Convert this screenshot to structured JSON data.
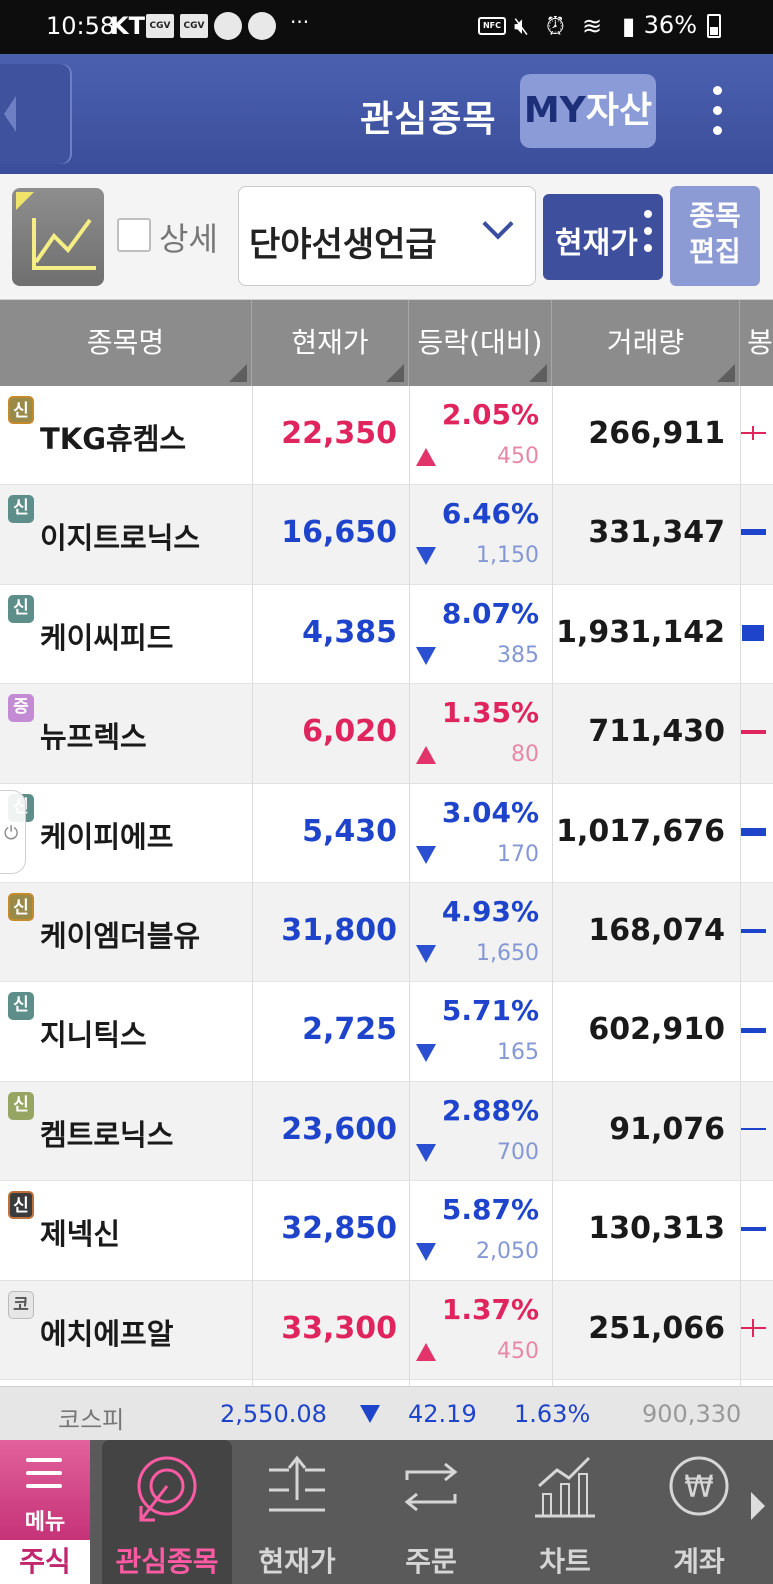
{
  "status_bar": {
    "time": "10:58",
    "carrier": "KT",
    "badges": [
      "CGV",
      "CGV"
    ],
    "dots": "···",
    "battery": "36%"
  },
  "header": {
    "title": "관심종목",
    "my_asset_prefix": "MY",
    "my_asset_suffix": "자산"
  },
  "toolbar": {
    "detail_label": "상세",
    "group_value": "단야선생언급",
    "price_mode": "현재가",
    "edit_line1": "종목",
    "edit_line2": "편집"
  },
  "columns": [
    "종목명",
    "현재가",
    "등락(대비)",
    "거래량",
    "봉"
  ],
  "rows": [
    {
      "badge": "신",
      "name": "TKG휴켐스",
      "price": "22,350",
      "pct": "2.05%",
      "diff": "450",
      "direction": "up",
      "volume": "266,911"
    },
    {
      "badge": "신",
      "name": "이지트로닉스",
      "price": "16,650",
      "pct": "6.46%",
      "diff": "1,150",
      "direction": "down",
      "volume": "331,347"
    },
    {
      "badge": "신",
      "name": "케이씨피드",
      "price": "4,385",
      "pct": "8.07%",
      "diff": "385",
      "direction": "down",
      "volume": "1,931,142"
    },
    {
      "badge": "증",
      "name": "뉴프렉스",
      "price": "6,020",
      "pct": "1.35%",
      "diff": "80",
      "direction": "up",
      "volume": "711,430"
    },
    {
      "badge": "신",
      "name": "케이피에프",
      "price": "5,430",
      "pct": "3.04%",
      "diff": "170",
      "direction": "down",
      "volume": "1,017,676"
    },
    {
      "badge": "신",
      "name": "케이엠더블유",
      "price": "31,800",
      "pct": "4.93%",
      "diff": "1,650",
      "direction": "down",
      "volume": "168,074"
    },
    {
      "badge": "신",
      "name": "지니틱스",
      "price": "2,725",
      "pct": "5.71%",
      "diff": "165",
      "direction": "down",
      "volume": "602,910"
    },
    {
      "badge": "신",
      "name": "켐트로닉스",
      "price": "23,600",
      "pct": "2.88%",
      "diff": "700",
      "direction": "down",
      "volume": "91,076"
    },
    {
      "badge": "신",
      "name": "제넥신",
      "price": "32,850",
      "pct": "5.87%",
      "diff": "2,050",
      "direction": "down",
      "volume": "130,313"
    },
    {
      "badge": "코",
      "name": "에치에프알",
      "price": "33,300",
      "pct": "1.37%",
      "diff": "450",
      "direction": "up",
      "volume": "251,066"
    }
  ],
  "index_bar": {
    "name": "코스피",
    "value": "2,550.08",
    "change": "42.19",
    "pct": "1.63%",
    "volume": "900,330"
  },
  "bottom_nav": {
    "menu_label": "메뉴",
    "stock_label": "주식",
    "items": [
      "관심종목",
      "현재가",
      "주문",
      "차트",
      "계좌"
    ]
  },
  "colors": {
    "header_bg": "#4b61b0",
    "up": "#e0245e",
    "down": "#1f44cc",
    "accent_pink": "#c2266e"
  }
}
